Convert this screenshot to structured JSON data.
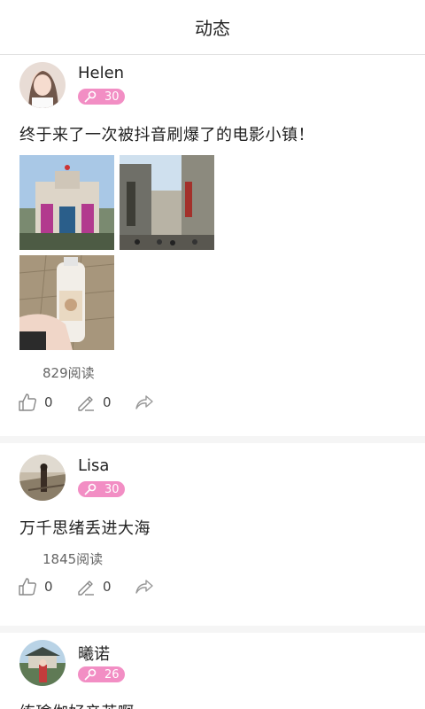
{
  "header": {
    "title": "动态"
  },
  "posts": [
    {
      "username": "Helen",
      "level": "30",
      "text": "终于来了一次被抖音刷爆了的电影小镇！",
      "reads": "829阅读",
      "likes": "0",
      "comments": "0"
    },
    {
      "username": "Lisa",
      "level": "30",
      "text": "万千思绪丢进大海",
      "reads": "1845阅读",
      "likes": "0",
      "comments": "0"
    },
    {
      "username": "曦诺",
      "level": "26",
      "text": "练瑜伽好辛苦啊"
    }
  ],
  "icons": {
    "key": "key-icon",
    "like": "thumbs-up-icon",
    "comment": "pencil-icon",
    "share": "share-arrow-icon"
  },
  "colors": {
    "badge": "#f28ec4",
    "divider": "#f5f5f5"
  }
}
